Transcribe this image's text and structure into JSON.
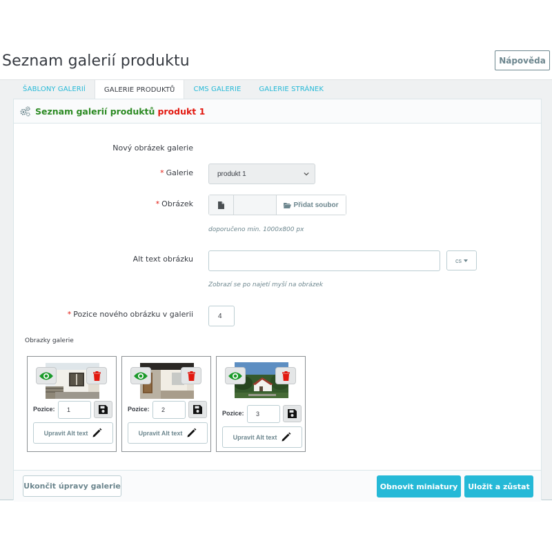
{
  "header": {
    "title": "Seznam galerií produktu",
    "help_label": "Nápověda"
  },
  "tabs": [
    {
      "label": "ŠABLONY GALERIÍ",
      "active": false
    },
    {
      "label": "GALERIE PRODUKTŮ",
      "active": true
    },
    {
      "label": "CMS GALERIE",
      "active": false
    },
    {
      "label": "GALERIE STRÁNEK",
      "active": false
    }
  ],
  "panel": {
    "title": "Seznam galerií produktů",
    "product": "produkt 1"
  },
  "form": {
    "new_image_heading": "Nový obrázek galerie",
    "required_mark": "*",
    "gallery_label": "Galerie",
    "gallery_value": "produkt 1",
    "image_label": "Obrázek",
    "add_file_label": "Přidat soubor",
    "image_hint": "doporučeno min. 1000x800 px",
    "alt_label": "Alt text obrázku",
    "alt_value": "",
    "lang_value": "cs",
    "alt_hint": "Zobrazí se po najetí myší na obrázek",
    "position_label": "Pozice nového obrázku v galerii",
    "position_value": "4"
  },
  "gallery": {
    "label": "Obrazky galerie",
    "position_label": "Pozice:",
    "alt_button_label": "Upravit Alt text",
    "images": [
      {
        "position": "1",
        "thumb": "house-with-window"
      },
      {
        "position": "2",
        "thumb": "interior-corridor"
      },
      {
        "position": "3",
        "thumb": "village-aerial"
      }
    ]
  },
  "footer": {
    "close_edit_label": "Ukončit úpravy galerie",
    "refresh_label": "Obnovit miniatury",
    "save_stay_label": "Uložit a zůstat"
  },
  "colors": {
    "accent": "#25b9d7",
    "title_green": "#2c8a23",
    "required_red": "#e2180f",
    "eye_green": "#1a9a2a",
    "delete_red": "#e2180f"
  }
}
